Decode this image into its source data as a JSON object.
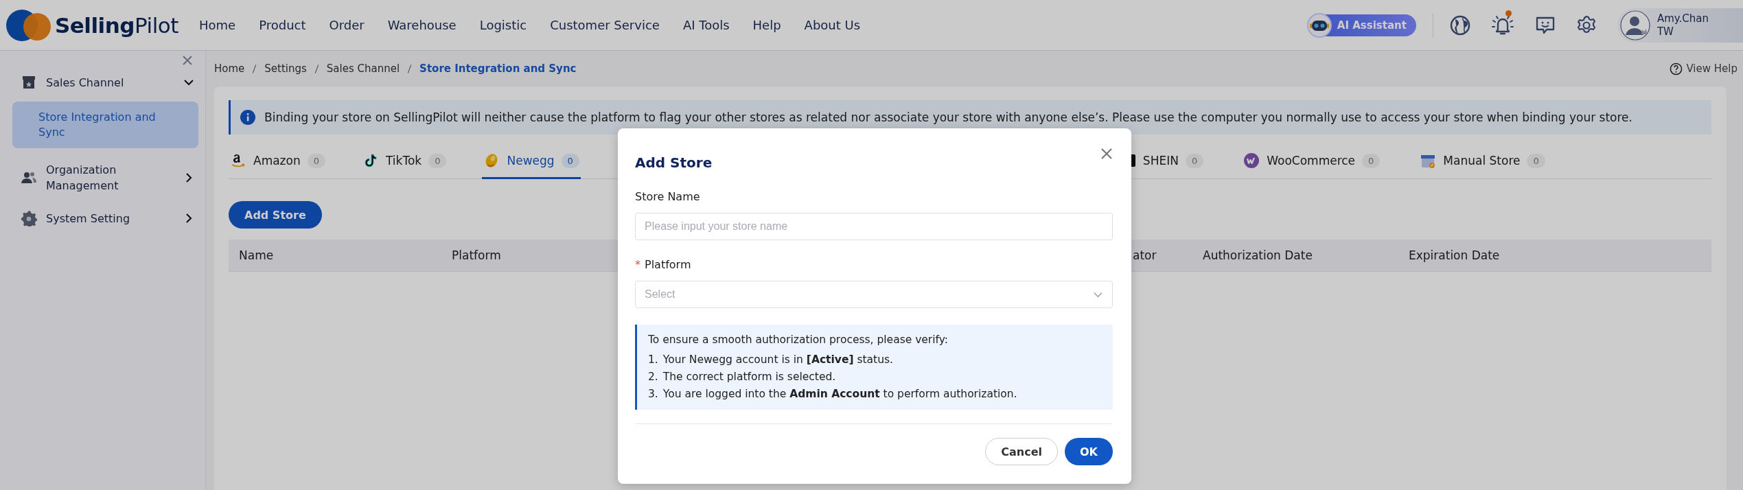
{
  "header": {
    "logo": "**Selling**Pilot",
    "nav": [
      "Home",
      "Product",
      "Order",
      "Warehouse",
      "Logistic",
      "Customer Service",
      "AI Tools",
      "Help",
      "About Us"
    ],
    "ai_assistant": "AI Assistant",
    "notifications": {
      "unread": true
    },
    "user": {
      "name": "Amy.Chan",
      "region": "TW"
    }
  },
  "sidebar": {
    "groups": [
      {
        "label": "Sales Channel",
        "expanded": true,
        "children": [
          {
            "label": "Store Integration and Sync",
            "selected": true
          }
        ]
      },
      {
        "label": "Organization Management",
        "expanded": false
      },
      {
        "label": "System Setting",
        "expanded": false
      }
    ]
  },
  "breadcrumb": [
    {
      "label": "Home",
      "current": false
    },
    {
      "label": "Settings",
      "current": false
    },
    {
      "label": "Sales Channel",
      "current": false
    },
    {
      "label": "Store Integration and Sync",
      "current": true
    }
  ],
  "view_help": "View Help",
  "info_banner": "Binding your store on SellingPilot will neither cause the platform to flag your other stores as related nor associate your store with anyone else’s. Please use the computer you normally use to access your store when binding your store.",
  "tabs": [
    {
      "label": "Amazon",
      "count": "0",
      "selected": false
    },
    {
      "label": "TikTok",
      "count": "0",
      "selected": false
    },
    {
      "label": "Newegg",
      "count": "0",
      "selected": true
    }
  ],
  "tabs_continued": [
    {
      "label": "SHEIN",
      "count": "0",
      "selected": false
    },
    {
      "label": "WooCommerce",
      "count": "0",
      "selected": false
    },
    {
      "label": "Manual Store",
      "count": "0",
      "selected": false
    }
  ],
  "add_store_button": "Add Store",
  "table": {
    "columns": [
      {
        "label": "Name"
      },
      {
        "label": "Platform"
      },
      {
        "label": "ator"
      },
      {
        "label": "Authorization Date"
      },
      {
        "label": "Expiration Date"
      }
    ]
  },
  "dialog": {
    "title": "Add Store",
    "fields": [
      {
        "label": "Store Name",
        "kind": "text",
        "placeholder": "Please input your store name"
      },
      {
        "label": "Platform",
        "required_mark": "*",
        "kind": "select",
        "placeholder": "Select"
      }
    ],
    "notice": {
      "intro": "To ensure a smooth authorization process, please verify:",
      "items": [
        {
          "number": "1.",
          "text": "Your Newegg account is in **[Active]** status."
        },
        {
          "number": "2.",
          "text": "The correct platform is selected."
        },
        {
          "number": "3.",
          "text": "You are logged into the **Admin Account** to perform authorization."
        }
      ]
    },
    "buttons": [
      {
        "label": "Cancel",
        "kind": "secondary"
      },
      {
        "label": "OK",
        "kind": "primary"
      }
    ]
  }
}
